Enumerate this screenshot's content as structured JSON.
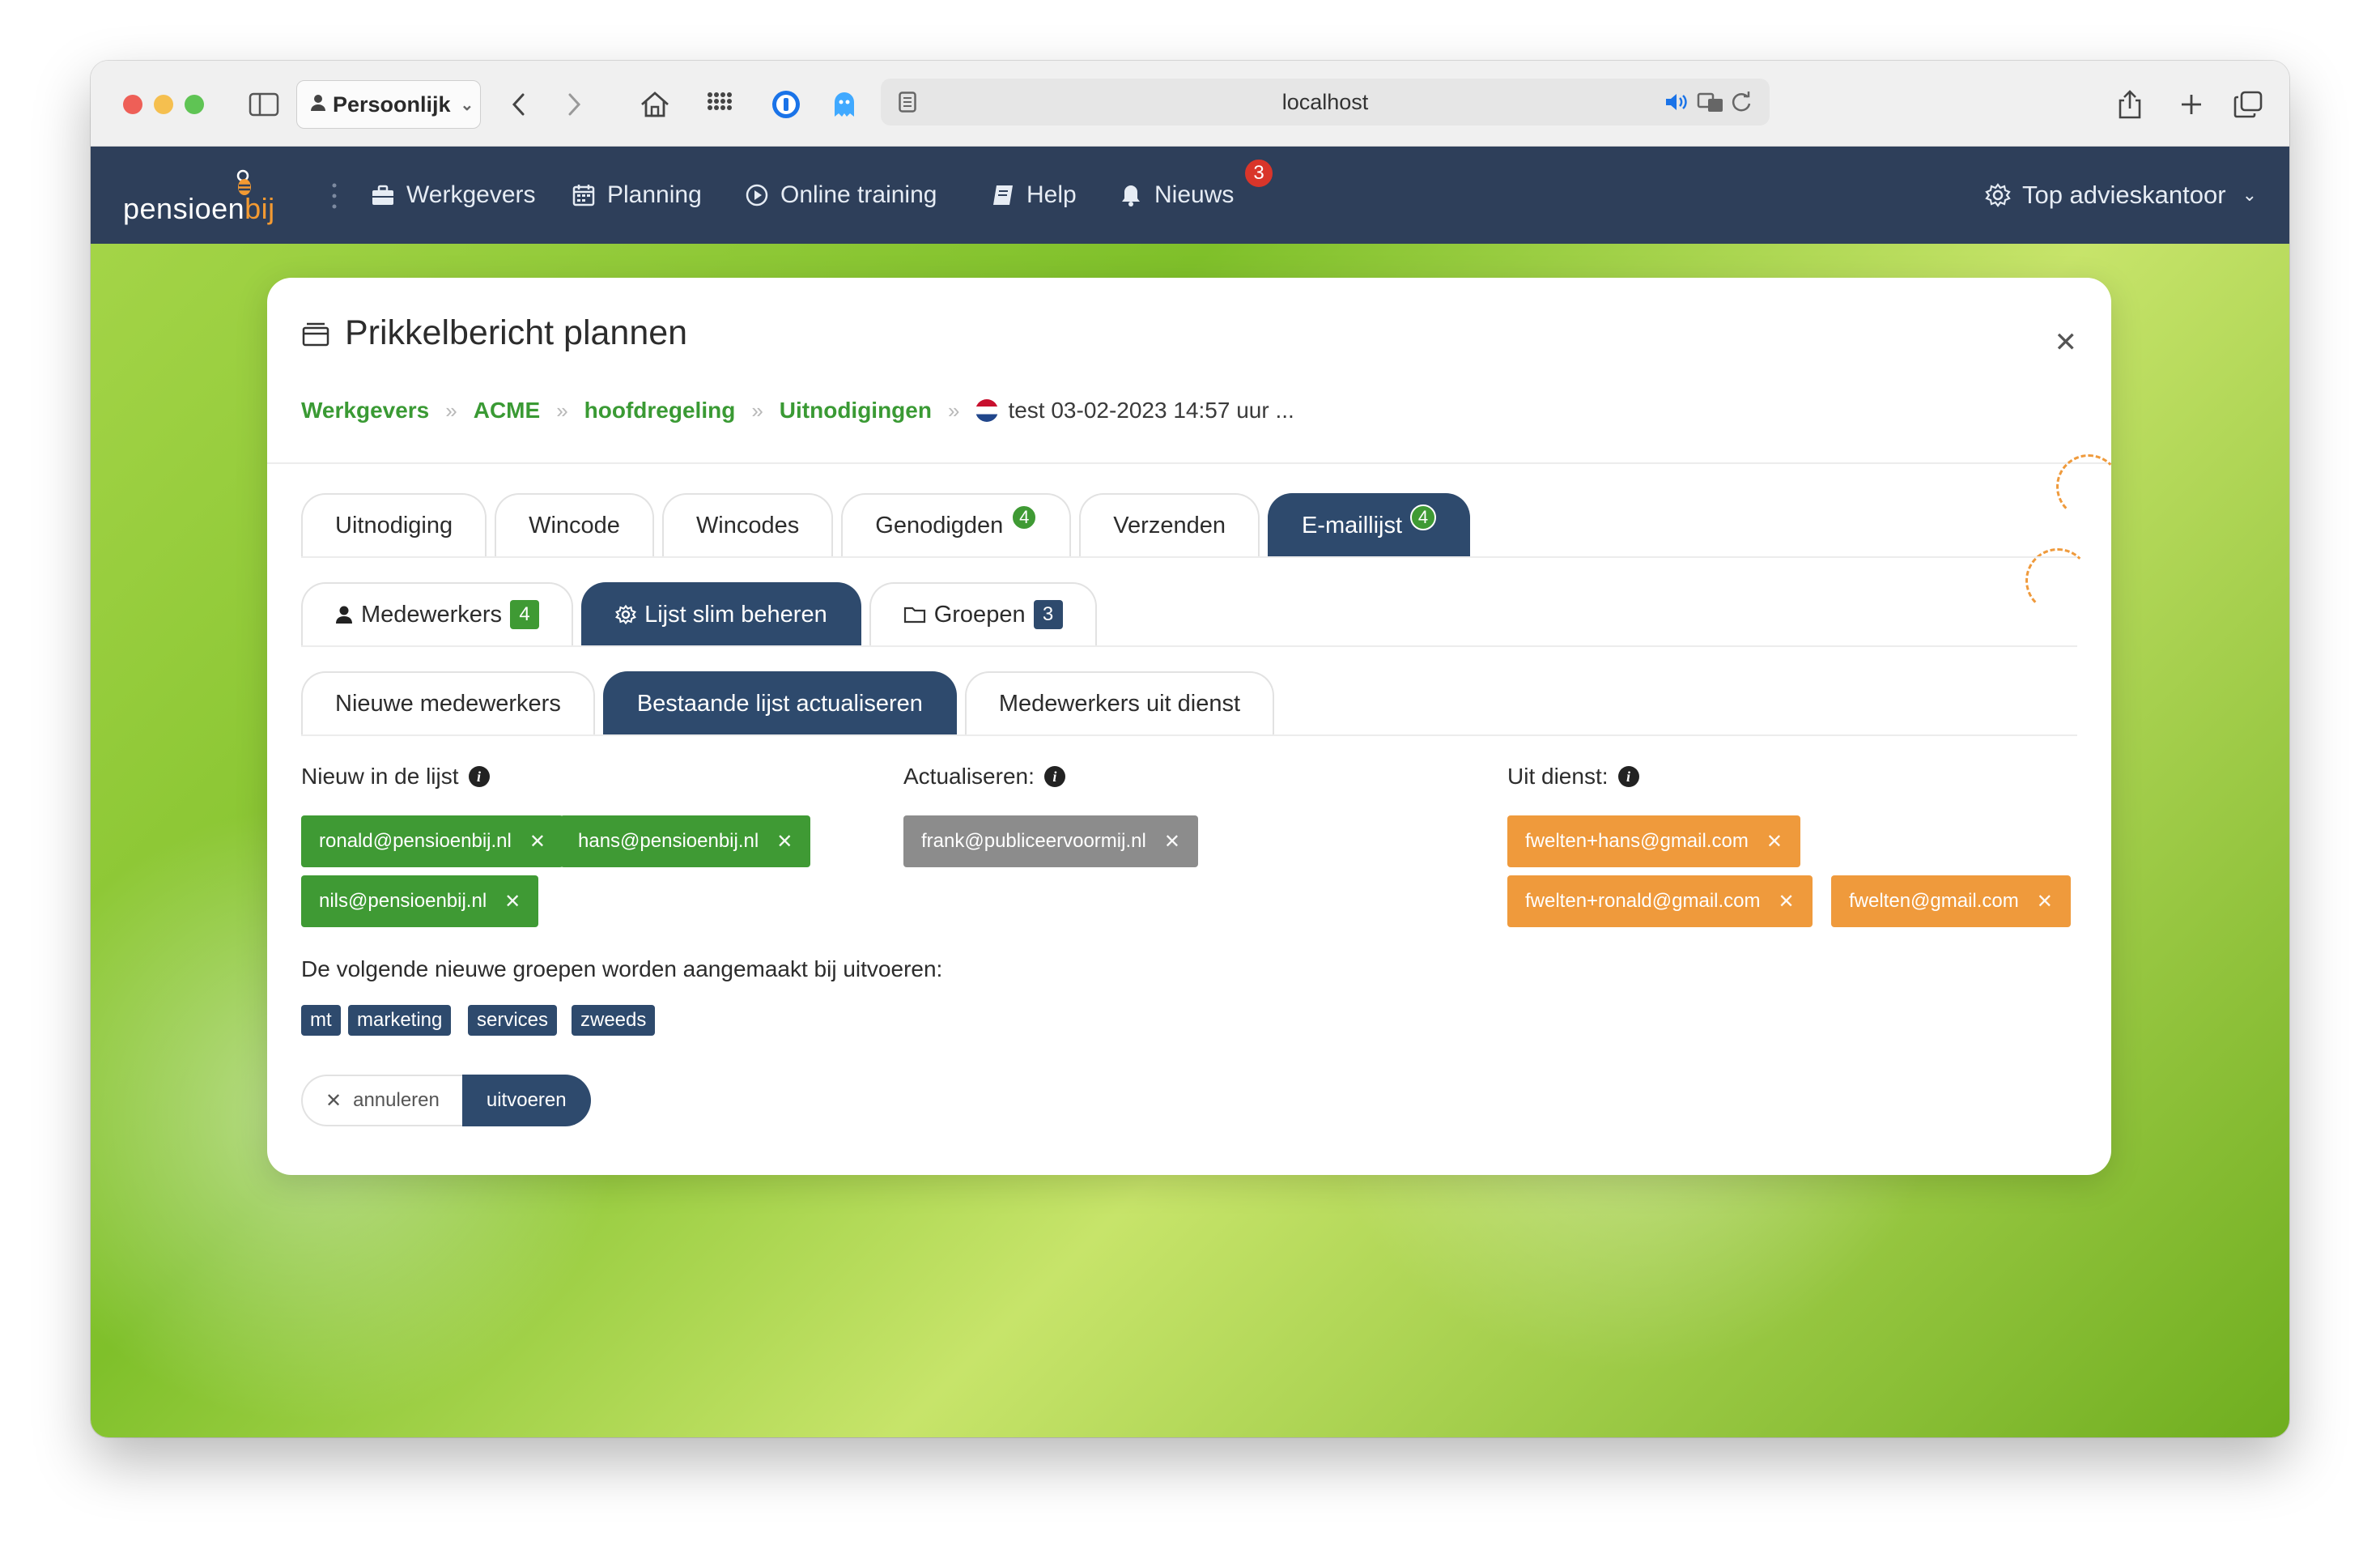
{
  "browser": {
    "profile": "Persoonlijk",
    "url": "localhost"
  },
  "site": {
    "logo_main": "pensioen",
    "logo_accent": "bij",
    "nav": [
      {
        "label": "Werkgevers",
        "icon": "briefcase-icon"
      },
      {
        "label": "Planning",
        "icon": "calendar-icon"
      },
      {
        "label": "Online training",
        "icon": "play-circle-icon"
      },
      {
        "label": "Help",
        "icon": "book-icon"
      },
      {
        "label": "Nieuws",
        "icon": "bell-icon"
      }
    ],
    "news_badge": "3",
    "account": "Top advieskantoor"
  },
  "modal": {
    "title": "Prikkelbericht plannen",
    "breadcrumbs": [
      "Werkgevers",
      "ACME",
      "hoofdregeling",
      "Uitnodigingen"
    ],
    "breadcrumb_last": "test 03-02-2023 14:57 uur ...",
    "tabs": [
      {
        "label": "Uitnodiging"
      },
      {
        "label": "Wincode"
      },
      {
        "label": "Wincodes"
      },
      {
        "label": "Genodigden",
        "count": "4"
      },
      {
        "label": "Verzenden"
      },
      {
        "label": "E-maillijst",
        "count": "4"
      }
    ],
    "subtabs": [
      {
        "label": "Medewerkers",
        "count": "4"
      },
      {
        "label": "Lijst slim beheren"
      },
      {
        "label": "Groepen",
        "count": "3"
      }
    ],
    "subsubtabs": [
      {
        "label": "Nieuwe medewerkers"
      },
      {
        "label": "Bestaande lijst actualiseren"
      },
      {
        "label": "Medewerkers uit dienst"
      }
    ],
    "columns": {
      "new_label": "Nieuw in de lijst",
      "new": [
        "ronald@pensioenbij.nl",
        "hans@pensioenbij.nl",
        "nils@pensioenbij.nl"
      ],
      "update_label": "Actualiseren:",
      "update": [
        "frank@publiceervoormij.nl"
      ],
      "out_label": "Uit dienst:",
      "out": [
        "fwelten+hans@gmail.com",
        "fwelten+ronald@gmail.com",
        "fwelten@gmail.com"
      ]
    },
    "groups_text": "De volgende nieuwe groepen worden aangemaakt bij uitvoeren:",
    "groups": [
      "mt",
      "marketing",
      "services",
      "zweeds"
    ],
    "cancel_label": "annuleren",
    "run_label": "uitvoeren",
    "colors": {
      "green": "#3f9a34",
      "navy": "#2e4a6d",
      "orange": "#ef9a3c",
      "gray": "#8c8c8c",
      "nav_bg": "#2e3f5a"
    }
  }
}
